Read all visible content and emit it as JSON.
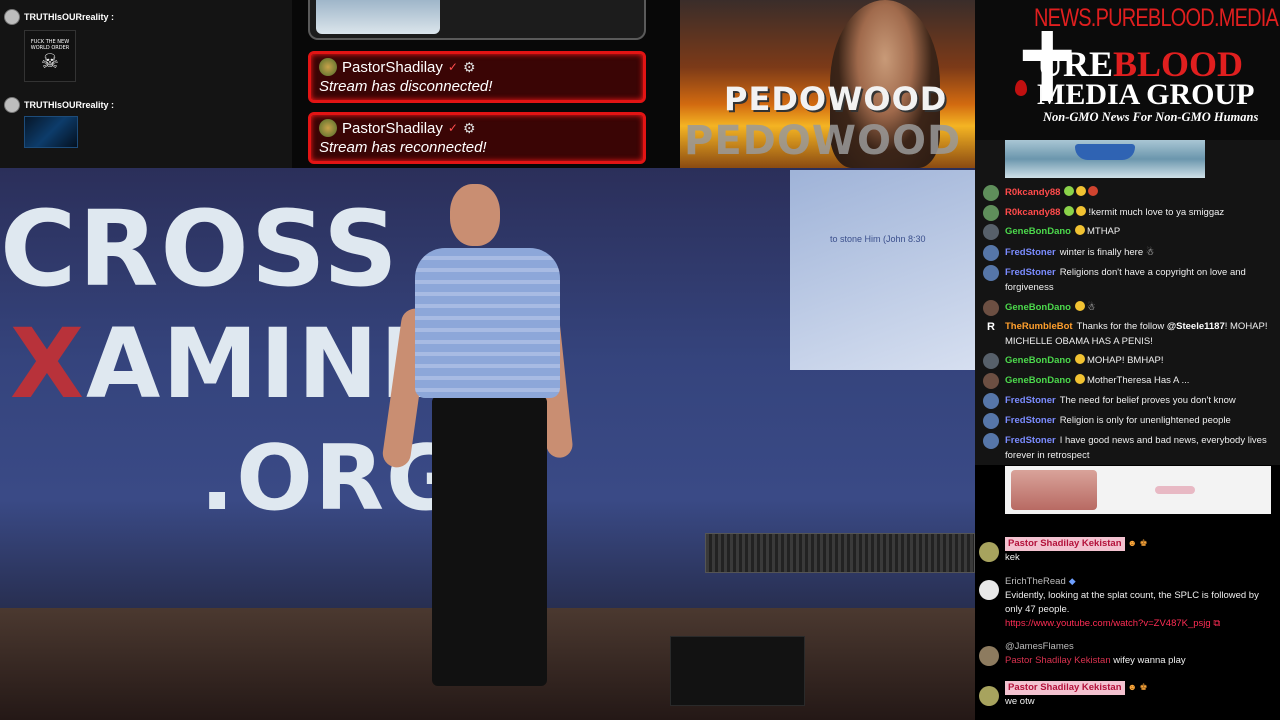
{
  "mini_chat": {
    "row1_user": "TRUTHIsOURreality :",
    "row1_caption": "FUCK THE NEW WORLD ORDER",
    "row2_user": "TRUTHIsOURreality :"
  },
  "alerts": [
    {
      "user": "PastorShadilay",
      "message": "Stream has disconnected!"
    },
    {
      "user": "PastorShadilay",
      "message": "Stream has reconnected!"
    }
  ],
  "banner": {
    "word1": "PEDOWOOD",
    "word2": "PEDOWOOD"
  },
  "brand": {
    "url": "NEWS.PUREBLOOD.MEDIA",
    "pure_p": "P",
    "pure_rest_white": "URE",
    "pure_rest_red": "BLOOD",
    "media_group": "MEDIA GROUP",
    "tagline": "Non-GMO News For Non-GMO Humans"
  },
  "video": {
    "logo_line1": "CROSS",
    "logo_line2_x": "X",
    "logo_line2_rest": "AMINED",
    "logo_line3": ".ORG",
    "screen_text": "to stone Him (John 8:30"
  },
  "chat1": [
    {
      "user": "R0kcandy88",
      "color": "#ff4b4b",
      "message": ""
    },
    {
      "user": "R0kcandy88",
      "color": "#ff4b4b",
      "message": "!kermit much love to ya smiggaz"
    },
    {
      "user": "GeneBonDano",
      "color": "#4cd84c",
      "message": "MTHAP"
    },
    {
      "user": "FredStoner",
      "color": "#7b8cff",
      "message": "winter is finally here ☃"
    },
    {
      "user": "FredStoner",
      "color": "#7b8cff",
      "message": "Religions don't have a copyright on love and forgiveness"
    },
    {
      "user": "GeneBonDano",
      "color": "#4cd84c",
      "message": "☃"
    },
    {
      "user": "TheRumbleBot",
      "color": "#ff9f2d",
      "message_pre": "Thanks for the follow ",
      "mention": "@Steele1187",
      "message_post": "! MOHAP! MICHELLE OBAMA HAS A PENIS!"
    },
    {
      "user": "GeneBonDano",
      "color": "#4cd84c",
      "message": "MOHAP! BMHAP!"
    },
    {
      "user": "GeneBonDano",
      "color": "#4cd84c",
      "message": "MotherTheresa Has A ..."
    },
    {
      "user": "FredStoner",
      "color": "#7b8cff",
      "message": "The need for belief proves you don't know"
    },
    {
      "user": "FredStoner",
      "color": "#7b8cff",
      "message": "Religion is only for unenlightened people"
    },
    {
      "user": "FredStoner",
      "color": "#7b8cff",
      "message": "I have good news and bad news, everybody lives forever in retrospect"
    }
  ],
  "chat2": [
    {
      "user": "Pastor Shadilay Kekistan",
      "message": "kek"
    },
    {
      "user": "ErichTheRead",
      "message": "Evidently, looking at the splat count, the SPLC is followed by only 47 people.",
      "link": "https://www.youtube.com/watch?v=ZV487K_psjg"
    },
    {
      "user": "@JamesFlames",
      "reply_to": "Pastor Shadilay Kekistan",
      "message": "wifey wanna play"
    },
    {
      "user": "Pastor Shadilay Kekistan",
      "message": "we otw"
    }
  ]
}
